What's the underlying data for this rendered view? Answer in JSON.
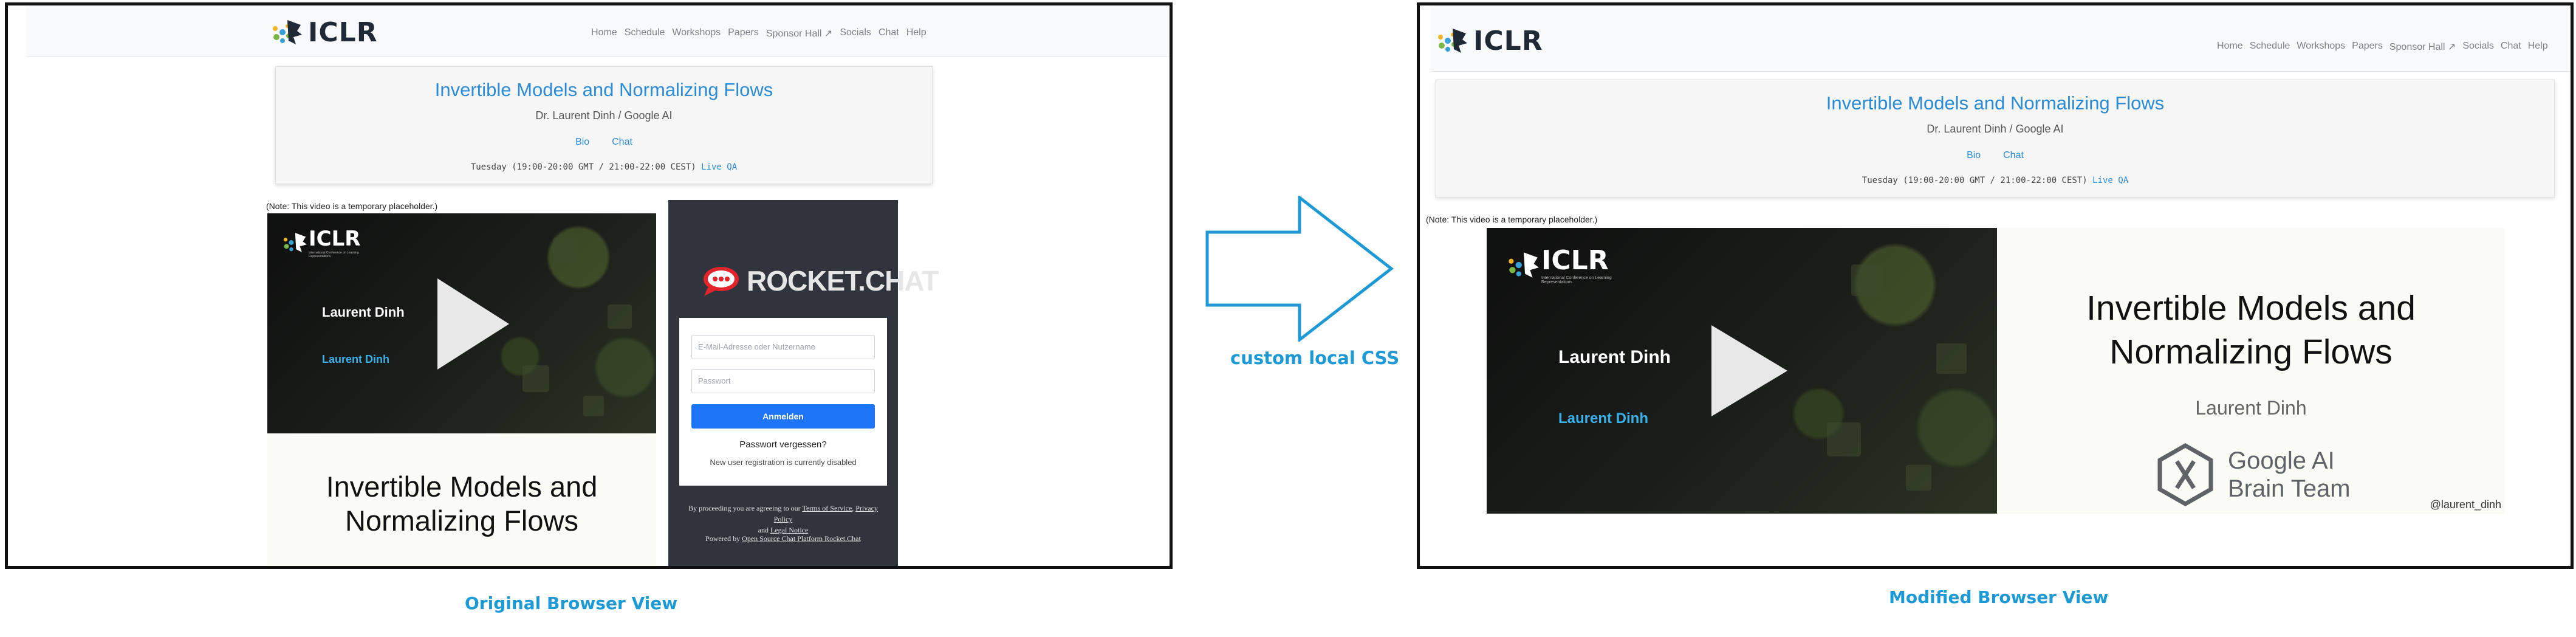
{
  "logo_text": "ICLR",
  "nav": [
    "Home",
    "Schedule",
    "Workshops",
    "Papers",
    "Sponsor Hall",
    "Socials",
    "Chat",
    "Help"
  ],
  "nav_external_icon": "external-link-icon",
  "talk": {
    "title": "Invertible Models and Normalizing Flows",
    "speaker": "Dr. Laurent Dinh / Google AI",
    "link_bio": "Bio",
    "link_chat": "Chat",
    "time": "Tuesday (19:00-20:00 GMT / 21:00-22:00 CEST)",
    "live_qa": "Live QA"
  },
  "note": "(Note: This video is a temporary placeholder.)",
  "video": {
    "presenter": "Laurent Dinh",
    "presenter_link": "Laurent Dinh",
    "logo_subtitle": "International Conference on Learning Representations"
  },
  "slide": {
    "title": "Invertible Models and Normalizing Flows",
    "author": "Laurent Dinh",
    "org_line1": "Google AI",
    "org_line2": "Brain Team",
    "handle": "@laurent_dinh"
  },
  "rocket_chat": {
    "brand": "ROCKET.CHAT",
    "email_placeholder": "E-Mail-Adresse oder Nutzername",
    "password_placeholder": "Passwort",
    "login_button": "Anmelden",
    "forgot": "Passwort vergessen?",
    "registration": "New user registration is currently disabled",
    "terms_prefix": "By proceeding you are agreeing to our",
    "terms": "Terms of Service",
    "privacy": "Privacy Policy",
    "and": "and",
    "legal": "Legal Notice",
    "powered_prefix": "Powered by",
    "powered": "Open Source Chat Platform Rocket.Chat"
  },
  "arrow_label": "custom local CSS",
  "caption_left": "Original Browser View",
  "caption_right": "Modified Browser View",
  "colors": {
    "accent": "#1d9ad6",
    "link": "#2b8bd4",
    "rocket_bg": "#2f343d",
    "rocket_button": "#1d74f5"
  }
}
